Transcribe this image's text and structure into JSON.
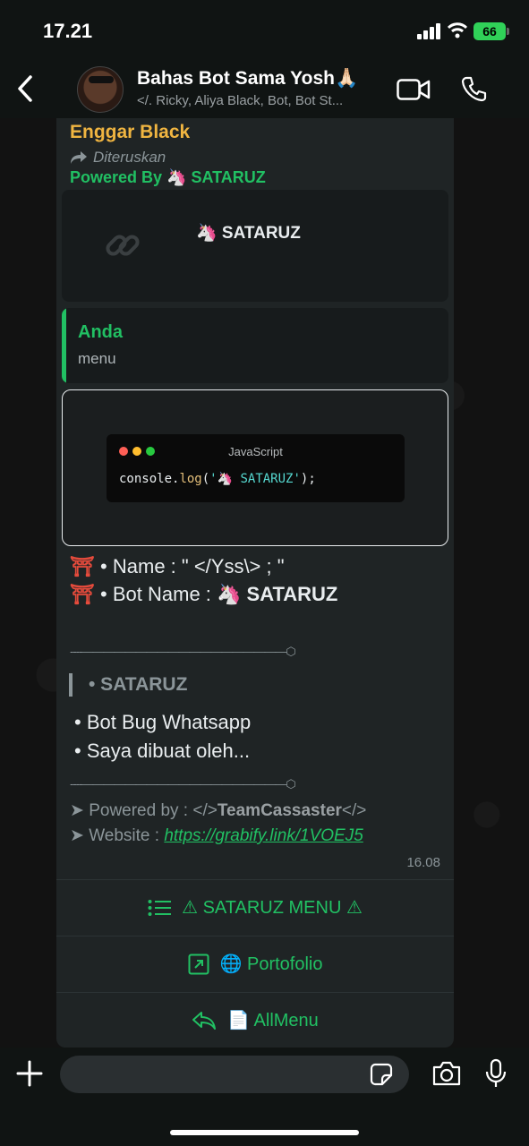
{
  "status": {
    "time": "17.21",
    "battery": "66"
  },
  "header": {
    "title": "Bahas Bot Sama Yosh🙏🏻",
    "subtitle": "</. Ricky, Aliya Black, Bot, Bot St..."
  },
  "message": {
    "sender": "Enggar Black",
    "forwarded": "Diteruskan",
    "powered_top": "Powered By 🦄 SATARUZ",
    "link_card_title": "🦄 SATARUZ",
    "quote": {
      "name": "Anda",
      "text": "menu"
    },
    "code": {
      "lang": "JavaScript",
      "prefix": "console.",
      "fn": "log",
      "open": "(",
      "str": "'🦄 SATARUZ'",
      "close": ");"
    },
    "info": [
      {
        "icon": "⛩",
        "label": " • Name : ",
        "value": "\" </Yss\\> ; \""
      },
      {
        "icon": "⛩",
        "label": " • Bot Name : ",
        "value": "🦄 SATARUZ"
      }
    ],
    "divider1": "----———————————————————⬡",
    "section_title": "• SATARUZ",
    "bullets": [
      "•  Bot Bug Whatsapp",
      "•  Saya dibuat oleh..."
    ],
    "divider2": "----———————————————————⬡",
    "powered_label": "➤ Powered by : </>",
    "powered_name": "TeamCassaster",
    "powered_end": "</>",
    "website_label": "➤ Website : ",
    "website_link": "https://grabify.link/1VOEJ5",
    "time": "16.08"
  },
  "buttons": [
    {
      "label": "⚠ SATARUZ MENU ⚠",
      "icon": "list-icon"
    },
    {
      "label": "🌐 Portofolio",
      "icon": "external-link-icon"
    },
    {
      "label": "📄 AllMenu",
      "icon": "reply-icon"
    }
  ],
  "colors": {
    "accent": "#21c063",
    "sender": "#f0b541",
    "bubble": "#1f2425"
  }
}
